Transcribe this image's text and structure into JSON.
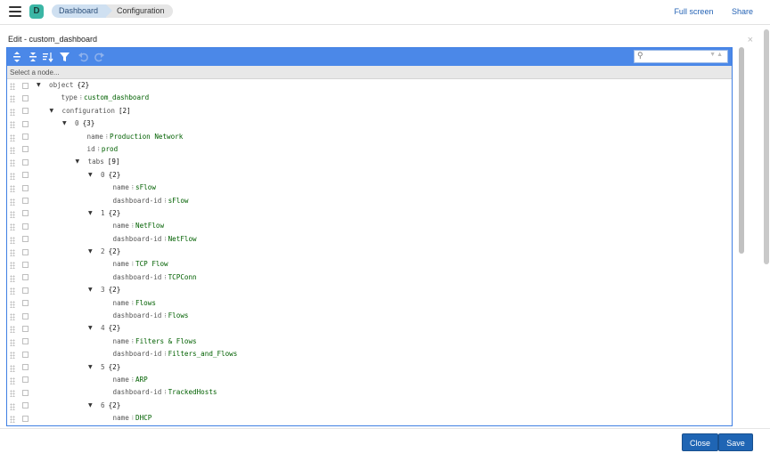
{
  "header": {
    "logo_letter": "D",
    "breadcrumbs": [
      "Dashboard",
      "Configuration"
    ],
    "full_screen_label": "Full screen",
    "share_label": "Share"
  },
  "modal": {
    "title": "Edit - custom_dashboard",
    "close_glyph": "×"
  },
  "toolbar": {
    "icons": [
      "expand-all-icon",
      "collapse-all-icon",
      "sort-icon",
      "filter-icon",
      "undo-icon",
      "redo-icon"
    ],
    "search_placeholder": ""
  },
  "navbar": {
    "text": "Select a node..."
  },
  "tree": [
    {
      "indent": 0,
      "expander": true,
      "key": "object",
      "count": "{2}"
    },
    {
      "indent": 1,
      "expander": false,
      "key": "type",
      "value": "custom_dashboard"
    },
    {
      "indent": 1,
      "expander": true,
      "key": "configuration",
      "count": "[2]"
    },
    {
      "indent": 2,
      "expander": true,
      "key": "0",
      "count": "{3}"
    },
    {
      "indent": 3,
      "expander": false,
      "key": "name",
      "value": "Production Network"
    },
    {
      "indent": 3,
      "expander": false,
      "key": "id",
      "value": "prod"
    },
    {
      "indent": 3,
      "expander": true,
      "key": "tabs",
      "count": "[9]"
    },
    {
      "indent": 4,
      "expander": true,
      "key": "0",
      "count": "{2}"
    },
    {
      "indent": 5,
      "expander": false,
      "key": "name",
      "value": "sFlow"
    },
    {
      "indent": 5,
      "expander": false,
      "key": "dashboard-id",
      "value": "sFlow"
    },
    {
      "indent": 4,
      "expander": true,
      "key": "1",
      "count": "{2}"
    },
    {
      "indent": 5,
      "expander": false,
      "key": "name",
      "value": "NetFlow"
    },
    {
      "indent": 5,
      "expander": false,
      "key": "dashboard-id",
      "value": "NetFlow"
    },
    {
      "indent": 4,
      "expander": true,
      "key": "2",
      "count": "{2}"
    },
    {
      "indent": 5,
      "expander": false,
      "key": "name",
      "value": "TCP Flow"
    },
    {
      "indent": 5,
      "expander": false,
      "key": "dashboard-id",
      "value": "TCPConn"
    },
    {
      "indent": 4,
      "expander": true,
      "key": "3",
      "count": "{2}"
    },
    {
      "indent": 5,
      "expander": false,
      "key": "name",
      "value": "Flows"
    },
    {
      "indent": 5,
      "expander": false,
      "key": "dashboard-id",
      "value": "Flows"
    },
    {
      "indent": 4,
      "expander": true,
      "key": "4",
      "count": "{2}"
    },
    {
      "indent": 5,
      "expander": false,
      "key": "name",
      "value": "Filters & Flows"
    },
    {
      "indent": 5,
      "expander": false,
      "key": "dashboard-id",
      "value": "Filters_and_Flows"
    },
    {
      "indent": 4,
      "expander": true,
      "key": "5",
      "count": "{2}"
    },
    {
      "indent": 5,
      "expander": false,
      "key": "name",
      "value": "ARP"
    },
    {
      "indent": 5,
      "expander": false,
      "key": "dashboard-id",
      "value": "TrackedHosts"
    },
    {
      "indent": 4,
      "expander": true,
      "key": "6",
      "count": "{2}"
    },
    {
      "indent": 5,
      "expander": false,
      "key": "name",
      "value": "DHCP"
    }
  ],
  "footer": {
    "close_label": "Close",
    "save_label": "Save"
  }
}
